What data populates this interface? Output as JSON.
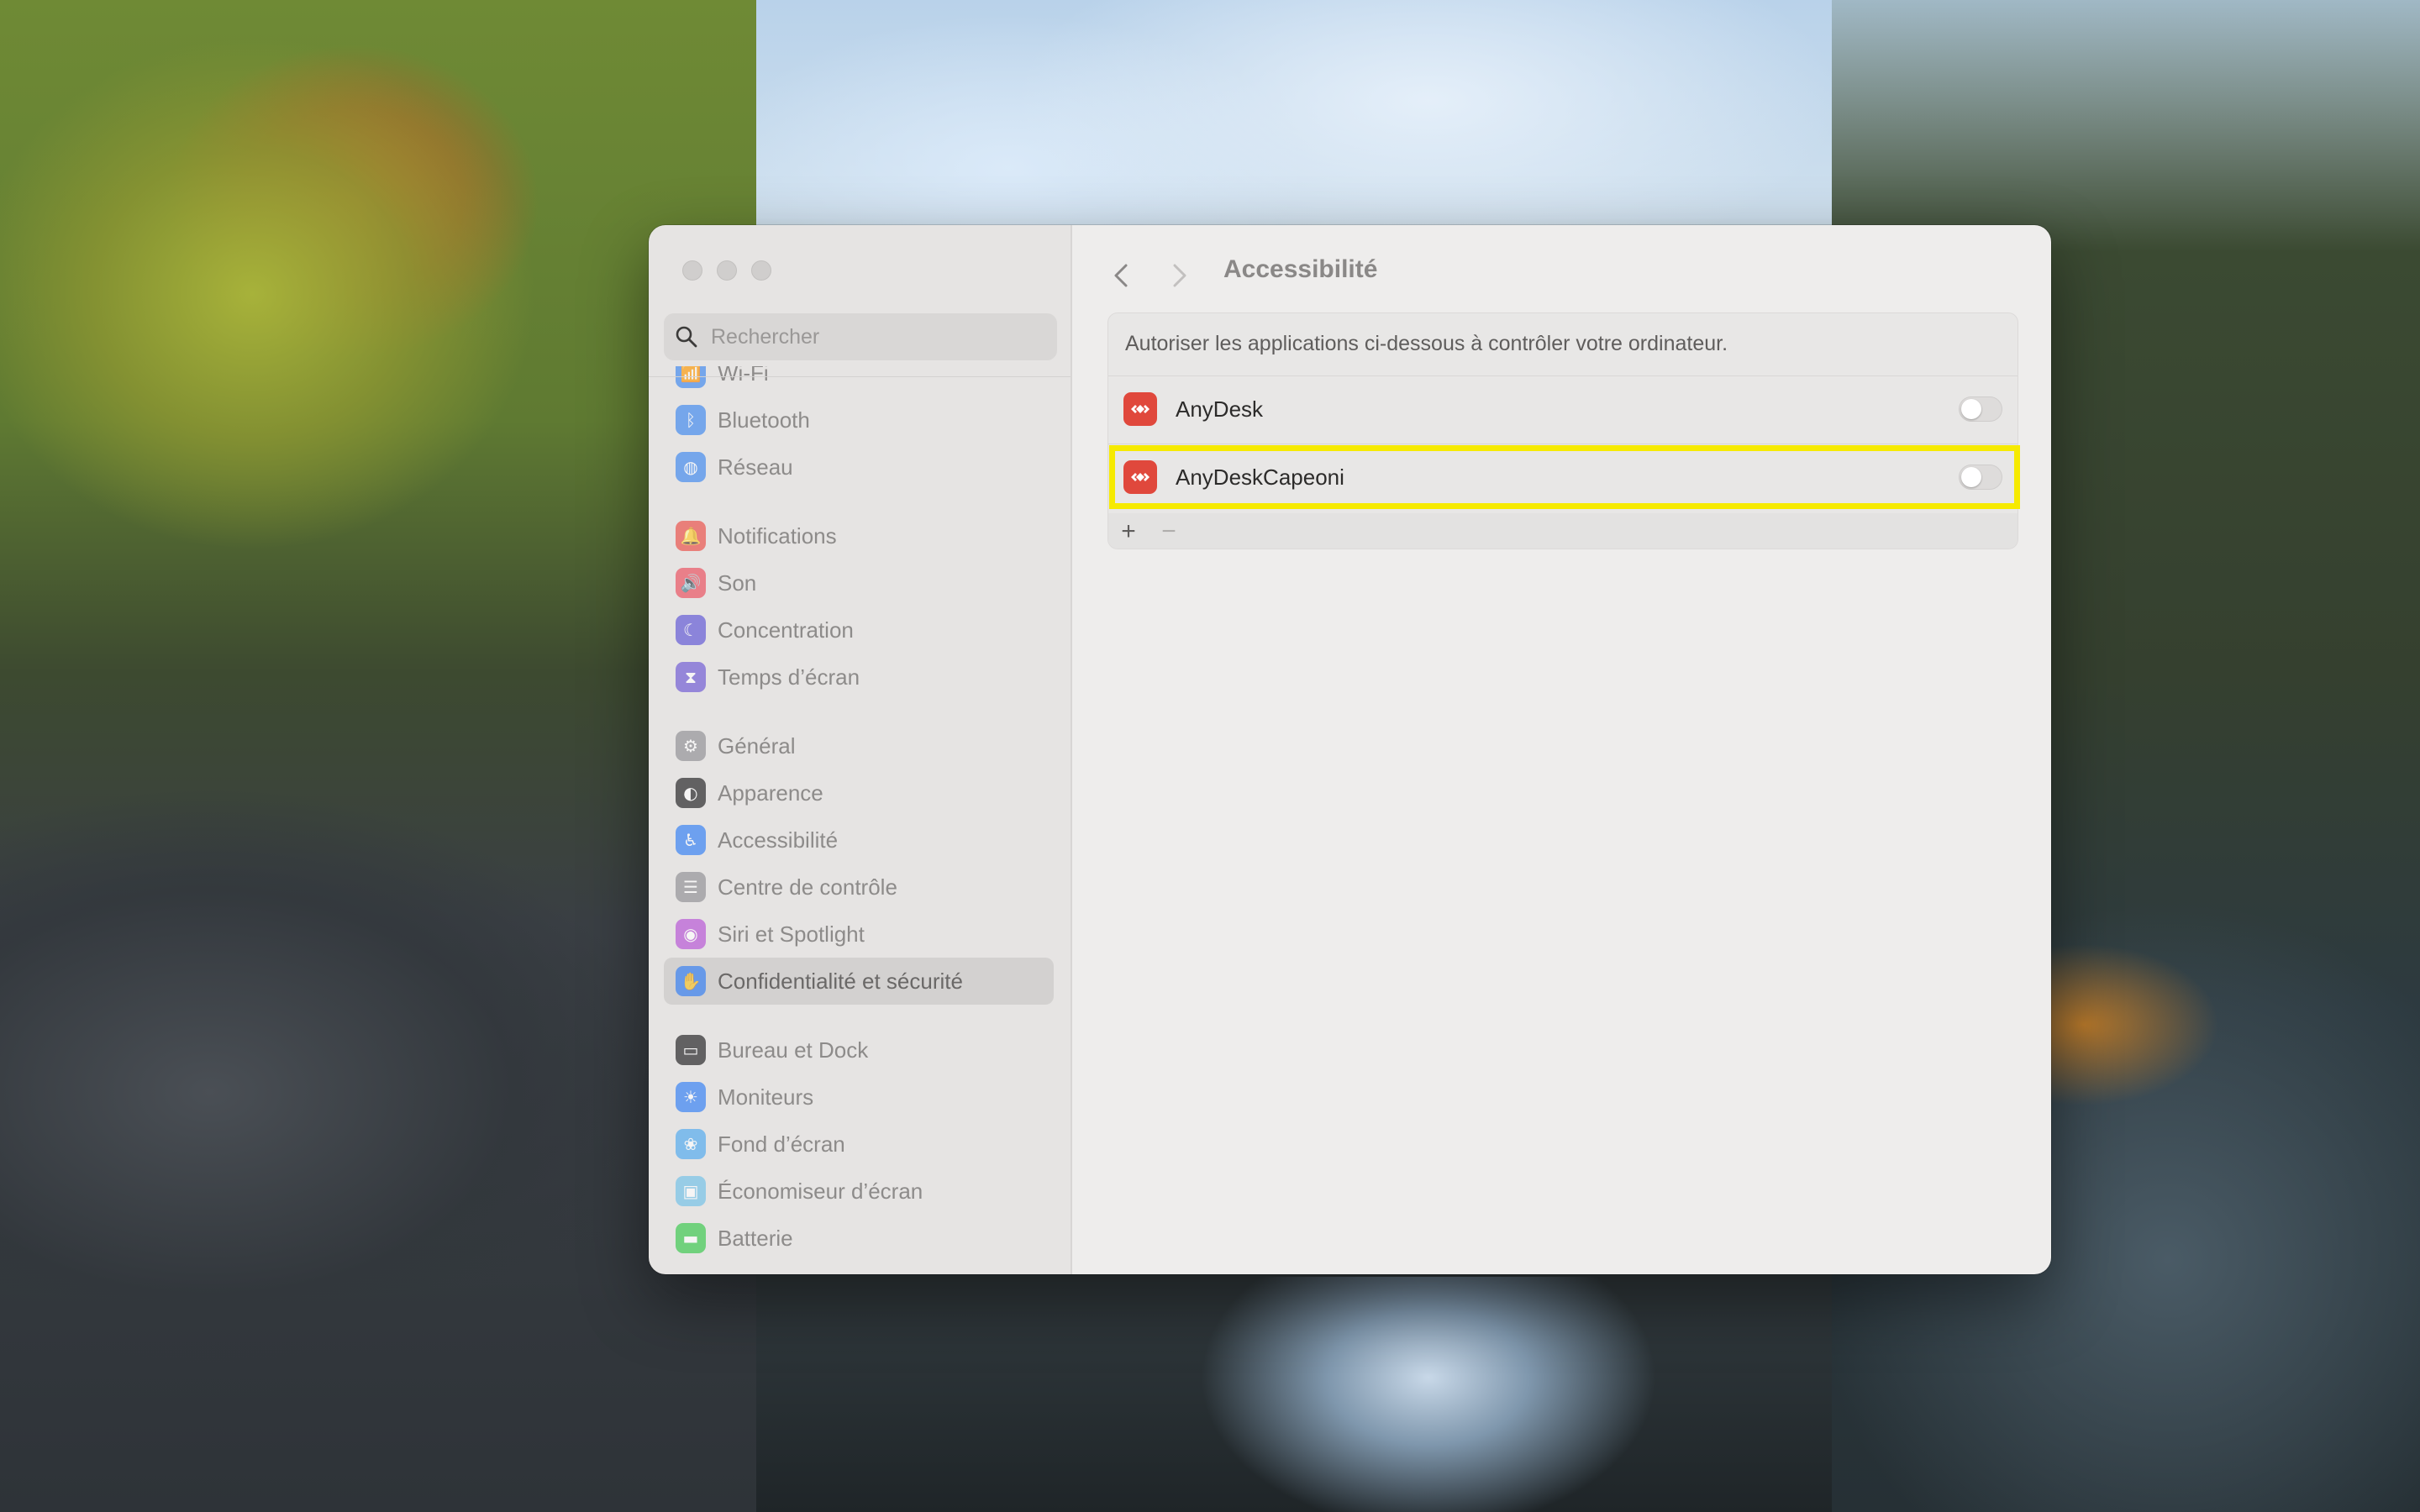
{
  "sidebar": {
    "search_placeholder": "Rechercher",
    "items": [
      {
        "label": "Wi-Fi",
        "icon": "wifi-icon",
        "color": "#3a86f0"
      },
      {
        "label": "Bluetooth",
        "icon": "bluetooth-icon",
        "color": "#3a86f0"
      },
      {
        "label": "Réseau",
        "icon": "globe-icon",
        "color": "#3a86f0"
      },
      {
        "label": "Notifications",
        "icon": "bell-icon",
        "color": "#ec4a43"
      },
      {
        "label": "Son",
        "icon": "speaker-icon",
        "color": "#ec4a5a"
      },
      {
        "label": "Concentration",
        "icon": "moon-icon",
        "color": "#5b52d6"
      },
      {
        "label": "Temps d’écran",
        "icon": "hourglass-icon",
        "color": "#6a55d4"
      },
      {
        "label": "Général",
        "icon": "gear-icon",
        "color": "#8e8e93"
      },
      {
        "label": "Apparence",
        "icon": "appearance-icon",
        "color": "#1c1c1e"
      },
      {
        "label": "Accessibilité",
        "icon": "accessibility-icon",
        "color": "#2e7cf6"
      },
      {
        "label": "Centre de contrôle",
        "icon": "control-center-icon",
        "color": "#8e8e93"
      },
      {
        "label": "Siri et Spotlight",
        "icon": "siri-icon",
        "color": "#b54fd6"
      },
      {
        "label": "Confidentialité et sécurité",
        "icon": "hand-icon",
        "color": "#2e7cf6"
      },
      {
        "label": "Bureau et Dock",
        "icon": "dock-icon",
        "color": "#1c1c1e"
      },
      {
        "label": "Moniteurs",
        "icon": "sun-icon",
        "color": "#2e7cf6"
      },
      {
        "label": "Fond d’écran",
        "icon": "wallpaper-icon",
        "color": "#4aa8f0"
      },
      {
        "label": "Économiseur d’écran",
        "icon": "screensaver-icon",
        "color": "#6ec0e8"
      },
      {
        "label": "Batterie",
        "icon": "battery-icon",
        "color": "#33c748"
      }
    ],
    "selected_label": "Confidentialité et sécurité"
  },
  "header": {
    "title": "Accessibilité"
  },
  "panel": {
    "description": "Autoriser les applications ci-dessous à contrôler votre ordinateur.",
    "apps": [
      {
        "name": "AnyDesk",
        "enabled": false,
        "icon": "anydesk-icon"
      },
      {
        "name": "AnyDeskCapeoni",
        "enabled": false,
        "icon": "anydesk-icon",
        "highlighted": true
      }
    ],
    "add_label": "+",
    "remove_label": "−"
  },
  "colors": {
    "anydesk_red": "#e0483c",
    "highlight_yellow": "#f6ea00"
  }
}
